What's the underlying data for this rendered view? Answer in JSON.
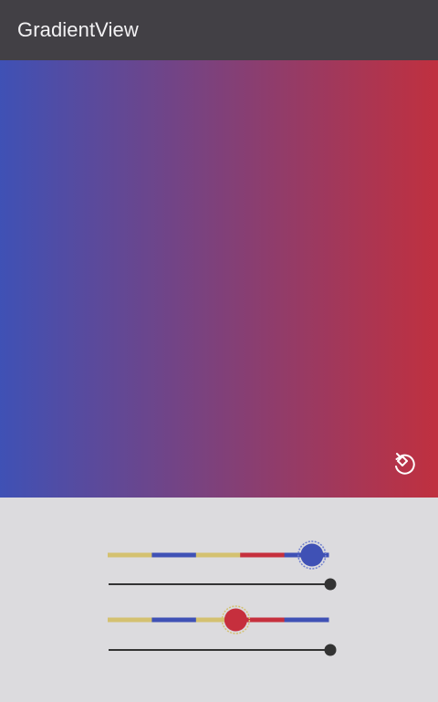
{
  "app_bar": {
    "title": "GradientView",
    "background": "#424045",
    "title_color": "#f3f2f4"
  },
  "gradient_view": {
    "direction": "left-to-right",
    "start_color": "#3f51b5",
    "end_color": "#c0303f",
    "rotate_button_icon": "screen-rotation-icon"
  },
  "controls": {
    "background": "#dcdbde",
    "color_slider_segments": [
      "#d4c170",
      "#3f51b5",
      "#d4c170",
      "#c62f3d",
      "#3f51b5"
    ],
    "start_color_slider": {
      "value": 0.925,
      "thumb_color": "#3f51b5"
    },
    "start_alpha_slider": {
      "value": 1.0,
      "thumb_color": "#333333"
    },
    "end_color_slider": {
      "value": 0.58,
      "thumb_color": "#c62f3d"
    },
    "end_alpha_slider": {
      "value": 1.0,
      "thumb_color": "#333333"
    }
  }
}
